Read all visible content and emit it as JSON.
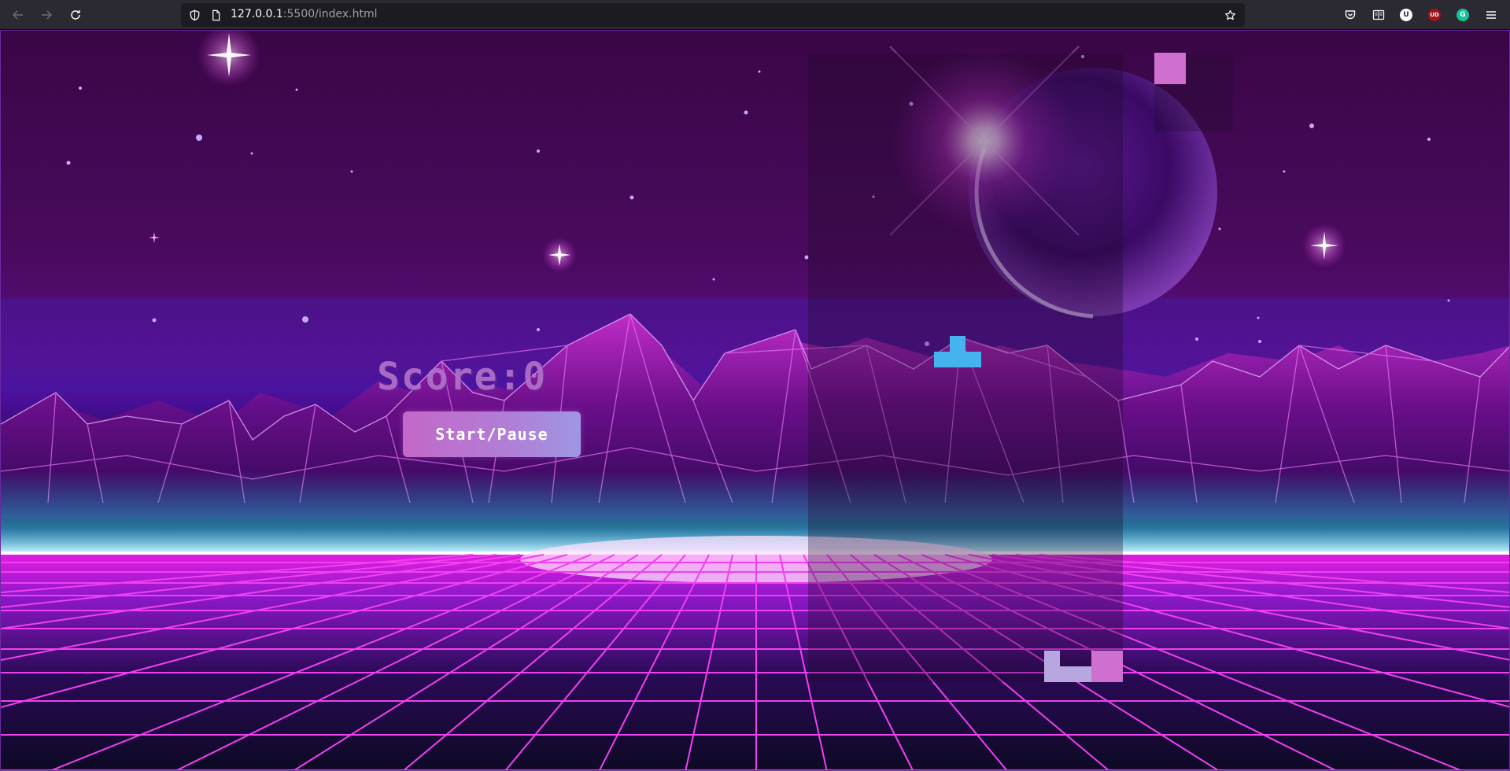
{
  "browser": {
    "url_host": "127.0.0.1",
    "url_path": ":5500/index.html",
    "icons": {
      "back": "back-arrow-icon",
      "forward": "forward-arrow-icon",
      "reload": "reload-icon",
      "tracking": "shield-icon",
      "page": "page-icon",
      "bookmark": "star-icon",
      "pocket": "pocket-icon",
      "reader": "reader-view-icon",
      "extension_u": "ublock-extension-icon",
      "extension_ud": "ud-extension-icon",
      "extension_g": "grammarly-extension-icon",
      "menu": "hamburger-menu-icon"
    },
    "ext_labels": {
      "u": "U",
      "ud": "UD",
      "g": "G"
    }
  },
  "game": {
    "score_label": "Score:",
    "score_value": "0",
    "start_pause_label": "Start/Pause",
    "colors": {
      "pink_block": "#cf6fcf",
      "blue_block": "#45b4ee",
      "lilac_block": "#b8a6e0",
      "button_from": "#c467c8",
      "button_to": "#9f96e3"
    }
  }
}
